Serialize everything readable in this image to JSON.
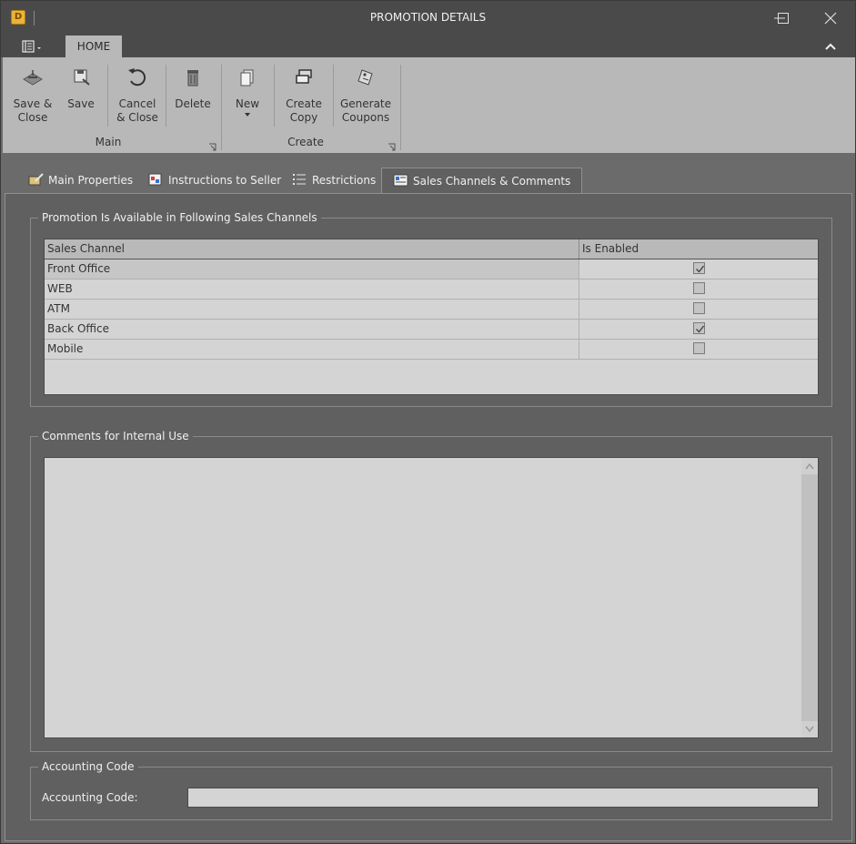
{
  "window": {
    "title": "PROMOTION DETAILS",
    "app_icon_letter": "D"
  },
  "menubar": {
    "home_tab": "HOME"
  },
  "ribbon": {
    "groups": [
      {
        "label": "Main"
      },
      {
        "label": "Create"
      }
    ],
    "buttons": {
      "save_close": [
        "Save &",
        "Close"
      ],
      "save": [
        "Save"
      ],
      "cancel_close": [
        "Cancel",
        "& Close"
      ],
      "delete": [
        "Delete"
      ],
      "new": [
        "New"
      ],
      "create_copy": [
        "Create",
        "Copy"
      ],
      "generate_coupons": [
        "Generate",
        "Coupons"
      ]
    }
  },
  "tabs": [
    {
      "label": "Main Properties",
      "icon": "edit-properties-icon"
    },
    {
      "label": "Instructions to Seller",
      "icon": "instructions-icon"
    },
    {
      "label": "Restrictions",
      "icon": "list-icon"
    },
    {
      "label": "Sales Channels & Comments",
      "icon": "comments-card-icon",
      "active": true
    }
  ],
  "sales_channels": {
    "group_title": "Promotion Is Available in Following Sales Channels",
    "columns": [
      "Sales Channel",
      "Is Enabled"
    ],
    "rows": [
      {
        "channel": "Front Office",
        "enabled": true
      },
      {
        "channel": "WEB",
        "enabled": false
      },
      {
        "channel": "ATM",
        "enabled": false
      },
      {
        "channel": "Back Office",
        "enabled": true
      },
      {
        "channel": "Mobile",
        "enabled": false
      }
    ]
  },
  "comments": {
    "group_title": "Comments for Internal Use",
    "value": ""
  },
  "accounting": {
    "group_title": "Accounting Code",
    "label": "Accounting Code:",
    "value": ""
  }
}
